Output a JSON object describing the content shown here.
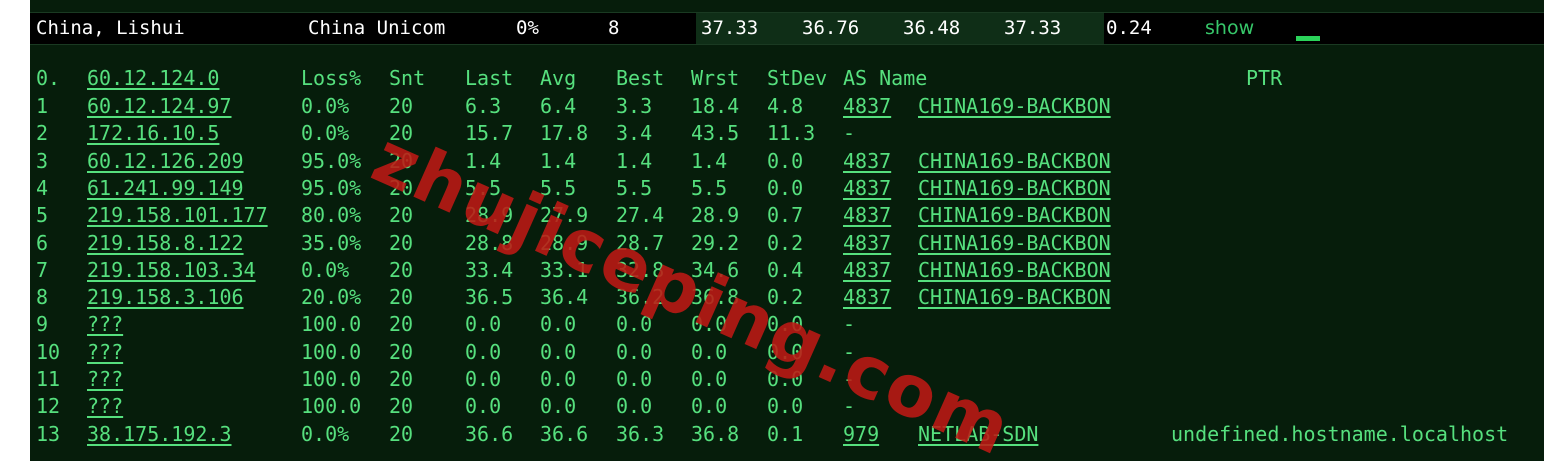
{
  "summary": {
    "location": "China, Lishui",
    "isp": "China Unicom",
    "loss": "0%",
    "count": "8",
    "v1": "37.33",
    "v2": "36.76",
    "v3": "36.48",
    "v4": "37.33",
    "v5": "0.24",
    "action_label": "show"
  },
  "headers": {
    "hop": "0.",
    "host": "60.12.124.0",
    "loss": "Loss%",
    "snt": "Snt",
    "last": "Last",
    "avg": "Avg",
    "best": "Best",
    "wrst": "Wrst",
    "stdev": "StDev",
    "as_name": "AS Name",
    "ptr": "PTR"
  },
  "hops": [
    {
      "hop": "1",
      "host": "60.12.124.97",
      "loss": "0.0%",
      "snt": "20",
      "last": "6.3",
      "avg": "6.4",
      "best": "3.3",
      "wrst": "18.4",
      "stdev": "4.8",
      "asn": "4837",
      "as_name": "CHINA169-BACKBON",
      "ptr": ""
    },
    {
      "hop": "2",
      "host": "172.16.10.5",
      "loss": "0.0%",
      "snt": "20",
      "last": "15.7",
      "avg": "17.8",
      "best": "3.4",
      "wrst": "43.5",
      "stdev": "11.3",
      "asn": "-",
      "as_name": "",
      "ptr": ""
    },
    {
      "hop": "3",
      "host": "60.12.126.209",
      "loss": "95.0%",
      "snt": "20",
      "last": "1.4",
      "avg": "1.4",
      "best": "1.4",
      "wrst": "1.4",
      "stdev": "0.0",
      "asn": "4837",
      "as_name": "CHINA169-BACKBON",
      "ptr": ""
    },
    {
      "hop": "4",
      "host": "61.241.99.149",
      "loss": "95.0%",
      "snt": "20",
      "last": "5.5",
      "avg": "5.5",
      "best": "5.5",
      "wrst": "5.5",
      "stdev": "0.0",
      "asn": "4837",
      "as_name": "CHINA169-BACKBON",
      "ptr": ""
    },
    {
      "hop": "5",
      "host": "219.158.101.177",
      "loss": "80.0%",
      "snt": "20",
      "last": "28.9",
      "avg": "27.9",
      "best": "27.4",
      "wrst": "28.9",
      "stdev": "0.7",
      "asn": "4837",
      "as_name": "CHINA169-BACKBON",
      "ptr": ""
    },
    {
      "hop": "6",
      "host": "219.158.8.122",
      "loss": "35.0%",
      "snt": "20",
      "last": "28.8",
      "avg": "28.9",
      "best": "28.7",
      "wrst": "29.2",
      "stdev": "0.2",
      "asn": "4837",
      "as_name": "CHINA169-BACKBON",
      "ptr": ""
    },
    {
      "hop": "7",
      "host": "219.158.103.34",
      "loss": "0.0%",
      "snt": "20",
      "last": "33.4",
      "avg": "33.1",
      "best": "32.8",
      "wrst": "34.6",
      "stdev": "0.4",
      "asn": "4837",
      "as_name": "CHINA169-BACKBON",
      "ptr": ""
    },
    {
      "hop": "8",
      "host": "219.158.3.106",
      "loss": "20.0%",
      "snt": "20",
      "last": "36.5",
      "avg": "36.4",
      "best": "36.2",
      "wrst": "36.8",
      "stdev": "0.2",
      "asn": "4837",
      "as_name": "CHINA169-BACKBON",
      "ptr": ""
    },
    {
      "hop": "9",
      "host": "???",
      "loss": "100.0",
      "snt": "20",
      "last": "0.0",
      "avg": "0.0",
      "best": "0.0",
      "wrst": "0.0",
      "stdev": "0.0",
      "asn": "-",
      "as_name": "",
      "ptr": ""
    },
    {
      "hop": "10",
      "host": "???",
      "loss": "100.0",
      "snt": "20",
      "last": "0.0",
      "avg": "0.0",
      "best": "0.0",
      "wrst": "0.0",
      "stdev": "0.0",
      "asn": "-",
      "as_name": "",
      "ptr": ""
    },
    {
      "hop": "11",
      "host": "???",
      "loss": "100.0",
      "snt": "20",
      "last": "0.0",
      "avg": "0.0",
      "best": "0.0",
      "wrst": "0.0",
      "stdev": "0.0",
      "asn": "-",
      "as_name": "",
      "ptr": ""
    },
    {
      "hop": "12",
      "host": "???",
      "loss": "100.0",
      "snt": "20",
      "last": "0.0",
      "avg": "0.0",
      "best": "0.0",
      "wrst": "0.0",
      "stdev": "0.0",
      "asn": "-",
      "as_name": "",
      "ptr": ""
    },
    {
      "hop": "13",
      "host": "38.175.192.3",
      "loss": "0.0%",
      "snt": "20",
      "last": "36.6",
      "avg": "36.6",
      "best": "36.3",
      "wrst": "36.8",
      "stdev": "0.1",
      "asn": "979",
      "as_name": "NETLAB-SDN",
      "ptr": "undefined.hostname.localhost"
    }
  ],
  "watermark": "zhujiceping.com",
  "colors": {
    "text_green": "#56e07e",
    "link_green": "#37c76a",
    "panel_bg": "#061d0b",
    "watermark_red": "#be1914"
  }
}
